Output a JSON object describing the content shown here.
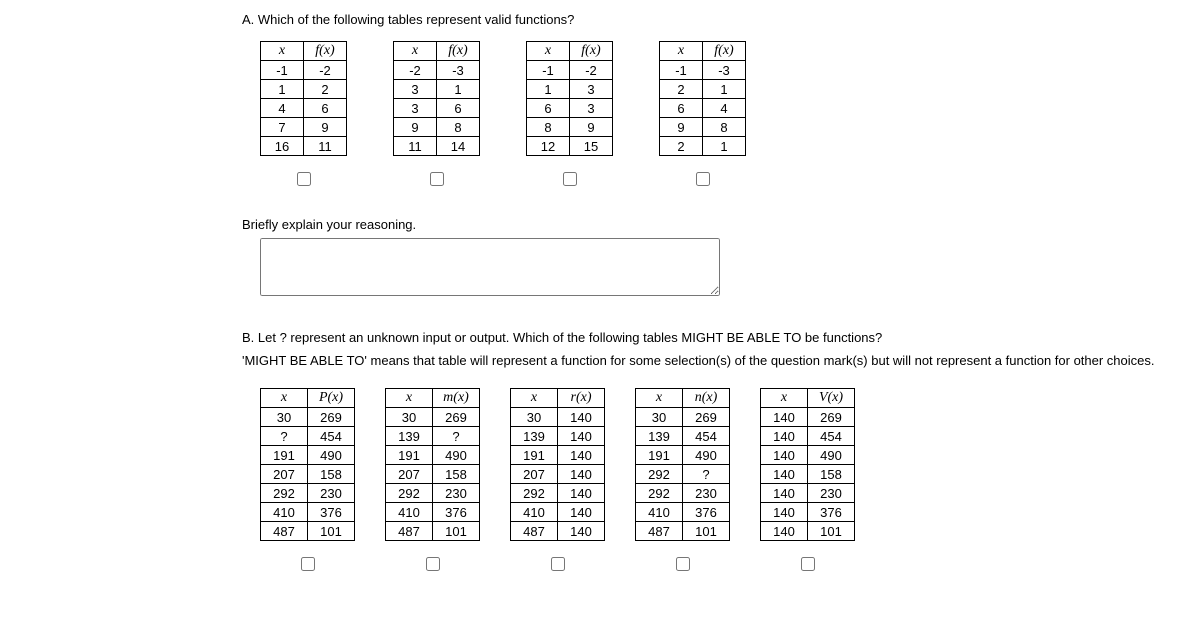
{
  "partA": {
    "prompt": "A. Which of the following tables represent valid functions?",
    "headers": {
      "x": "x",
      "fx": "f(x)"
    },
    "tables": [
      {
        "rows": [
          [
            "-1",
            "-2"
          ],
          [
            "1",
            "2"
          ],
          [
            "4",
            "6"
          ],
          [
            "7",
            "9"
          ],
          [
            "16",
            "11"
          ]
        ]
      },
      {
        "rows": [
          [
            "-2",
            "-3"
          ],
          [
            "3",
            "1"
          ],
          [
            "3",
            "6"
          ],
          [
            "9",
            "8"
          ],
          [
            "11",
            "14"
          ]
        ]
      },
      {
        "rows": [
          [
            "-1",
            "-2"
          ],
          [
            "1",
            "3"
          ],
          [
            "6",
            "3"
          ],
          [
            "8",
            "9"
          ],
          [
            "12",
            "15"
          ]
        ]
      },
      {
        "rows": [
          [
            "-1",
            "-3"
          ],
          [
            "2",
            "1"
          ],
          [
            "6",
            "4"
          ],
          [
            "9",
            "8"
          ],
          [
            "2",
            "1"
          ]
        ]
      }
    ],
    "explain_label": "Briefly explain your reasoning."
  },
  "partB": {
    "prompt": "B. Let ? represent an unknown input or output. Which of the following tables MIGHT BE ABLE TO be functions?",
    "clarify": "'MIGHT BE ABLE TO' means that table will represent a function for some selection(s) of the question mark(s) but will not represent a function for other choices.",
    "headers": {
      "x": "x"
    },
    "tables": [
      {
        "fn": "P(x)",
        "rows": [
          [
            "30",
            "269"
          ],
          [
            "?",
            "454"
          ],
          [
            "191",
            "490"
          ],
          [
            "207",
            "158"
          ],
          [
            "292",
            "230"
          ],
          [
            "410",
            "376"
          ],
          [
            "487",
            "101"
          ]
        ]
      },
      {
        "fn": "m(x)",
        "rows": [
          [
            "30",
            "269"
          ],
          [
            "139",
            "?"
          ],
          [
            "191",
            "490"
          ],
          [
            "207",
            "158"
          ],
          [
            "292",
            "230"
          ],
          [
            "410",
            "376"
          ],
          [
            "487",
            "101"
          ]
        ]
      },
      {
        "fn": "r(x)",
        "rows": [
          [
            "30",
            "140"
          ],
          [
            "139",
            "140"
          ],
          [
            "191",
            "140"
          ],
          [
            "207",
            "140"
          ],
          [
            "292",
            "140"
          ],
          [
            "410",
            "140"
          ],
          [
            "487",
            "140"
          ]
        ]
      },
      {
        "fn": "n(x)",
        "rows": [
          [
            "30",
            "269"
          ],
          [
            "139",
            "454"
          ],
          [
            "191",
            "490"
          ],
          [
            "292",
            "?"
          ],
          [
            "292",
            "230"
          ],
          [
            "410",
            "376"
          ],
          [
            "487",
            "101"
          ]
        ]
      },
      {
        "fn": "V(x)",
        "rows": [
          [
            "140",
            "269"
          ],
          [
            "140",
            "454"
          ],
          [
            "140",
            "490"
          ],
          [
            "140",
            "158"
          ],
          [
            "140",
            "230"
          ],
          [
            "140",
            "376"
          ],
          [
            "140",
            "101"
          ]
        ]
      }
    ]
  }
}
